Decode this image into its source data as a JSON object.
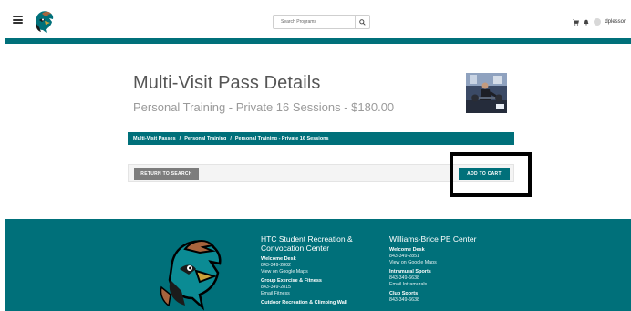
{
  "header": {
    "search": {
      "placeholder": "Search Programs"
    },
    "user": {
      "name": "dplessor"
    }
  },
  "main": {
    "title": "Multi-Visit Pass Details",
    "subtitle": "Personal Training - Private 16 Sessions - $180.00",
    "breadcrumb": [
      "Multi-Visit Passes",
      "Personal Training",
      "Personal Training - Private 16 Sessions"
    ],
    "breadcrumb_separator": "/",
    "buttons": {
      "return": "RETURN TO SEARCH",
      "add_to_cart": "ADD TO CART"
    }
  },
  "footer": {
    "col1": {
      "title": "HTC Student Recreation & Convocation Center",
      "sections": [
        {
          "head": "Welcome Desk",
          "lines": [
            "843-349-2802"
          ],
          "link": "View on Google Maps"
        },
        {
          "head": "Group Exercise & Fitness",
          "lines": [
            "843-349-2815"
          ],
          "link": "Email Fitness"
        },
        {
          "head": "Outdoor Recreation & Climbing Wall",
          "lines": [],
          "link": ""
        }
      ]
    },
    "col2": {
      "title": "Williams-Brice PE Center",
      "sections": [
        {
          "head": "Welcome Desk",
          "lines": [
            "843-349-2851"
          ],
          "link": "View on Google Maps"
        },
        {
          "head": "Intramural Sports",
          "lines": [
            "843-349-6638"
          ],
          "link": "Email Intramurals"
        },
        {
          "head": "Club Sports",
          "lines": [
            "843-349-6638"
          ],
          "link": ""
        }
      ]
    }
  },
  "colors": {
    "brand_teal": "#00707a",
    "button_gray": "#7d7d7d",
    "highlight": "#000000"
  },
  "icons": [
    "hamburger-menu-icon",
    "mascot-logo",
    "search-icon",
    "cart-icon",
    "bell-icon",
    "user-avatar-icon"
  ]
}
